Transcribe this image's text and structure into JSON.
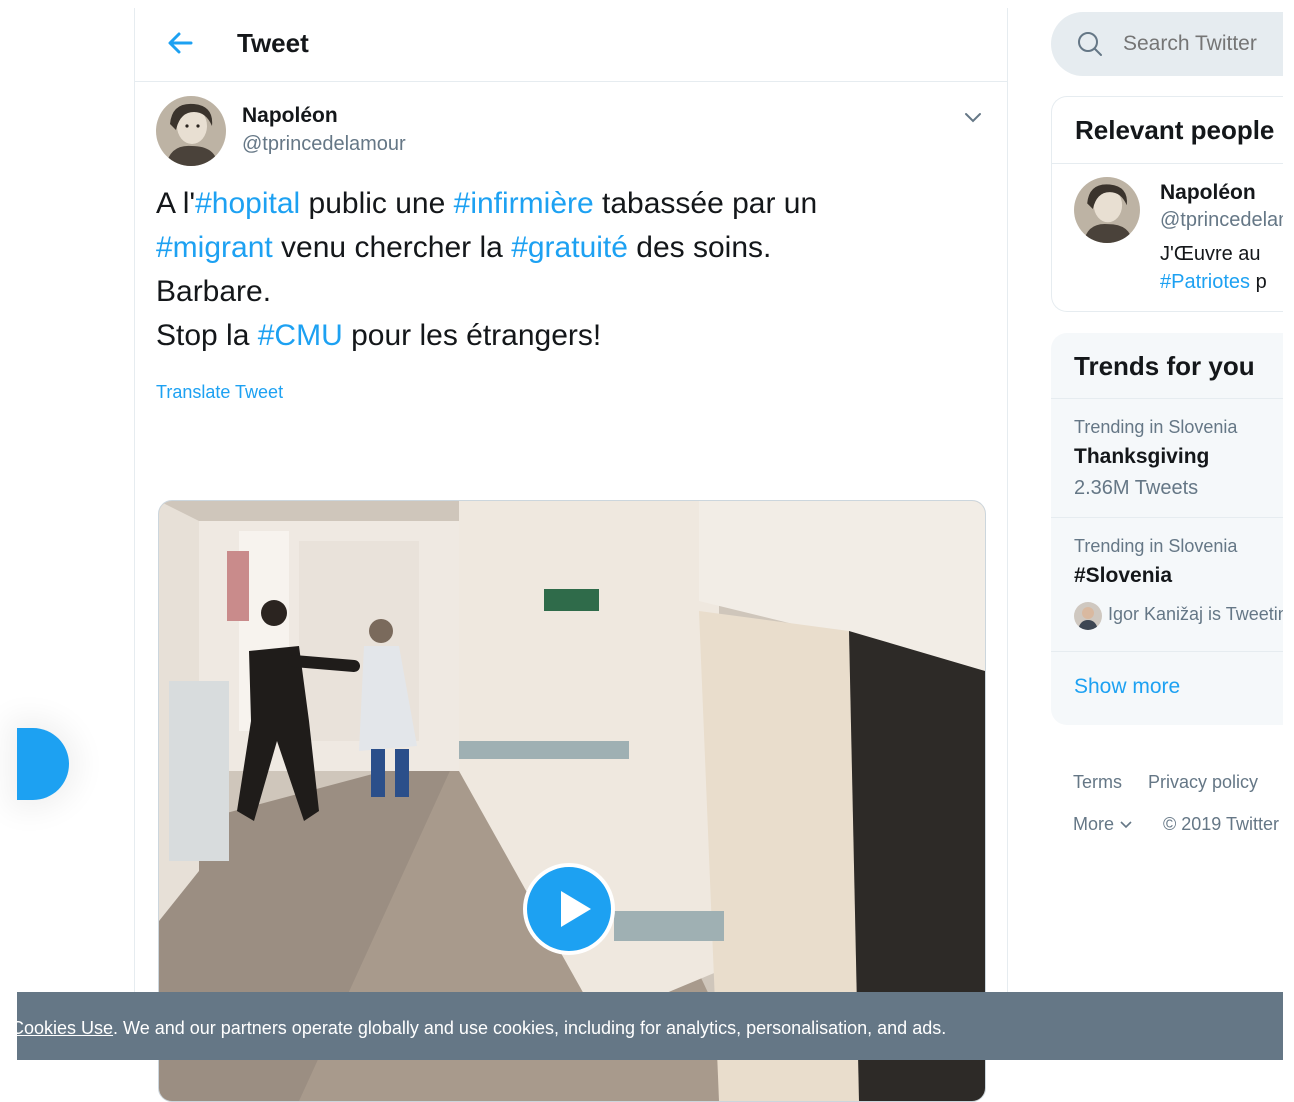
{
  "header": {
    "title": "Tweet"
  },
  "tweet": {
    "author_name": "Napoléon",
    "author_handle": "@tprincedelamour",
    "text": {
      "l1_a": "A l'",
      "l1_tag1": "#hopital",
      "l1_b": " public une ",
      "l1_tag2": "#infirmière",
      "l1_c": " tabassée par un",
      "l2_tag1": "#migrant",
      "l2_a": " venu chercher la ",
      "l2_tag2": "#gratuité",
      "l2_b": " des soins.",
      "l3": "Barbare.",
      "l4_a": "Stop la ",
      "l4_tag": "#CMU",
      "l4_b": " pour les étrangers!"
    },
    "translate_label": "Translate Tweet"
  },
  "search": {
    "placeholder": "Search Twitter"
  },
  "relevant_people": {
    "title": "Relevant people",
    "person": {
      "name": "Napoléon",
      "handle": "@tprincedelamour",
      "bio_line1": "J'Œuvre au ",
      "bio_tag": "#Patriotes",
      "bio_after": " p"
    }
  },
  "trends": {
    "title": "Trends for you",
    "items": [
      {
        "context": "Trending in Slovenia",
        "name": "Thanksgiving",
        "count": "2.36M Tweets"
      },
      {
        "context": "Trending in Slovenia",
        "name": "#Slovenia",
        "user_line": "Igor Kanižaj is Tweeting about this"
      }
    ],
    "show_more": "Show more"
  },
  "footer": {
    "terms": "Terms",
    "privacy": "Privacy policy",
    "more": "More",
    "copyright": "© 2019 Twitter"
  },
  "cookie_banner": {
    "link": "Cookies Use",
    "text": ". We and our partners operate globally and use cookies, including for analytics, personalisation, and ads."
  },
  "colors": {
    "accent": "#1da1f2",
    "muted": "#657786",
    "banner": "#657786"
  }
}
